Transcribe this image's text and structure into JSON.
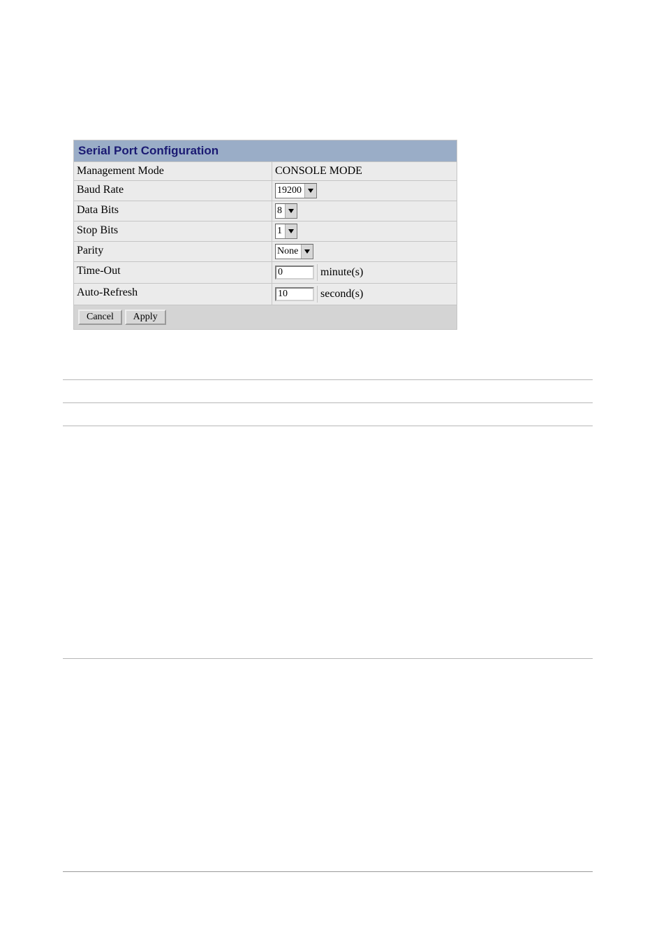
{
  "panel": {
    "title": "Serial Port Configuration",
    "rows": {
      "management_mode": {
        "label": "Management Mode",
        "value": "CONSOLE MODE"
      },
      "baud_rate": {
        "label": "Baud Rate",
        "value": "19200"
      },
      "data_bits": {
        "label": "Data Bits",
        "value": "8"
      },
      "stop_bits": {
        "label": "Stop Bits",
        "value": "1"
      },
      "parity": {
        "label": "Parity",
        "value": "None"
      },
      "time_out": {
        "label": "Time-Out",
        "value": "0",
        "unit": "minute(s)"
      },
      "auto_refresh": {
        "label": "Auto-Refresh",
        "value": "10",
        "unit": "second(s)"
      }
    },
    "buttons": {
      "cancel": "Cancel",
      "apply": "Apply"
    }
  }
}
